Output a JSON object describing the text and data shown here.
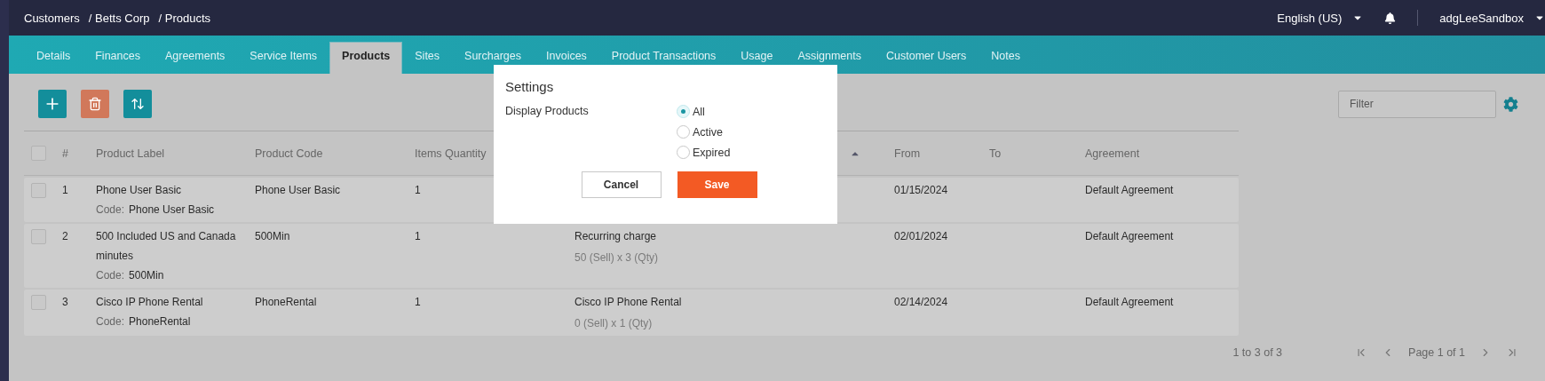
{
  "breadcrumb": [
    "Customers",
    "/ Betts Corp",
    "/ Products"
  ],
  "language": "English (US)",
  "username": "adgLeeSandbox",
  "tabs": [
    {
      "label": "Details",
      "selected": false
    },
    {
      "label": "Finances",
      "selected": false
    },
    {
      "label": "Agreements",
      "selected": false
    },
    {
      "label": "Service Items",
      "selected": false
    },
    {
      "label": "Products",
      "selected": true
    },
    {
      "label": "Sites",
      "selected": false
    },
    {
      "label": "Surcharges",
      "selected": false
    },
    {
      "label": "Invoices",
      "selected": false
    },
    {
      "label": "Product Transactions",
      "selected": false
    },
    {
      "label": "Usage",
      "selected": false
    },
    {
      "label": "Assignments",
      "selected": false
    },
    {
      "label": "Customer Users",
      "selected": false
    },
    {
      "label": "Notes",
      "selected": false
    }
  ],
  "filter": {
    "placeholder": "Filter"
  },
  "table": {
    "header_checked": false,
    "columns": [
      {
        "label": "#",
        "sorted": false
      },
      {
        "label": "Product Label",
        "sorted": false
      },
      {
        "label": "Product Code",
        "sorted": false
      },
      {
        "label": "Items Quantity",
        "sorted": false
      },
      {
        "sorted": true
      },
      {
        "label": "From",
        "sorted": false
      },
      {
        "label": "To",
        "sorted": false
      },
      {
        "label": "Agreement",
        "sorted": false
      }
    ],
    "rows": [
      {
        "checked": false,
        "number": "1",
        "label": "Phone User Basic",
        "code_prefix": "Code:",
        "code": "Phone User Basic",
        "product_code": "Phone User Basic",
        "quantity": "1",
        "from": "01/15/2024",
        "agreement": "Default Agreement"
      },
      {
        "checked": false,
        "number": "2",
        "label": "500 Included US and Canada minutes",
        "code_prefix": "Code:",
        "code": "500Min",
        "product_code": "500Min",
        "quantity": "1",
        "charge_title": "Recurring charge",
        "charge_detail": "50 (Sell) x 3 (Qty)",
        "from": "02/01/2024",
        "agreement": "Default Agreement"
      },
      {
        "checked": false,
        "number": "3",
        "label": "Cisco IP Phone Rental",
        "code_prefix": "Code:",
        "code": "PhoneRental",
        "product_code": "PhoneRental",
        "quantity": "1",
        "charge_title": "Cisco IP Phone Rental",
        "charge_detail": "0 (Sell) x 1 (Qty)",
        "from": "02/14/2024",
        "agreement": "Default Agreement"
      }
    ]
  },
  "pagination": {
    "summary": "1 to 3 of 3",
    "page": "Page 1 of 1"
  },
  "dialog": {
    "title": "Settings",
    "field_label": "Display Products",
    "options": [
      {
        "label": "All",
        "selected": true
      },
      {
        "label": "Active",
        "selected": false
      },
      {
        "label": "Expired",
        "selected": false
      }
    ],
    "cancel": "Cancel",
    "save": "Save"
  }
}
